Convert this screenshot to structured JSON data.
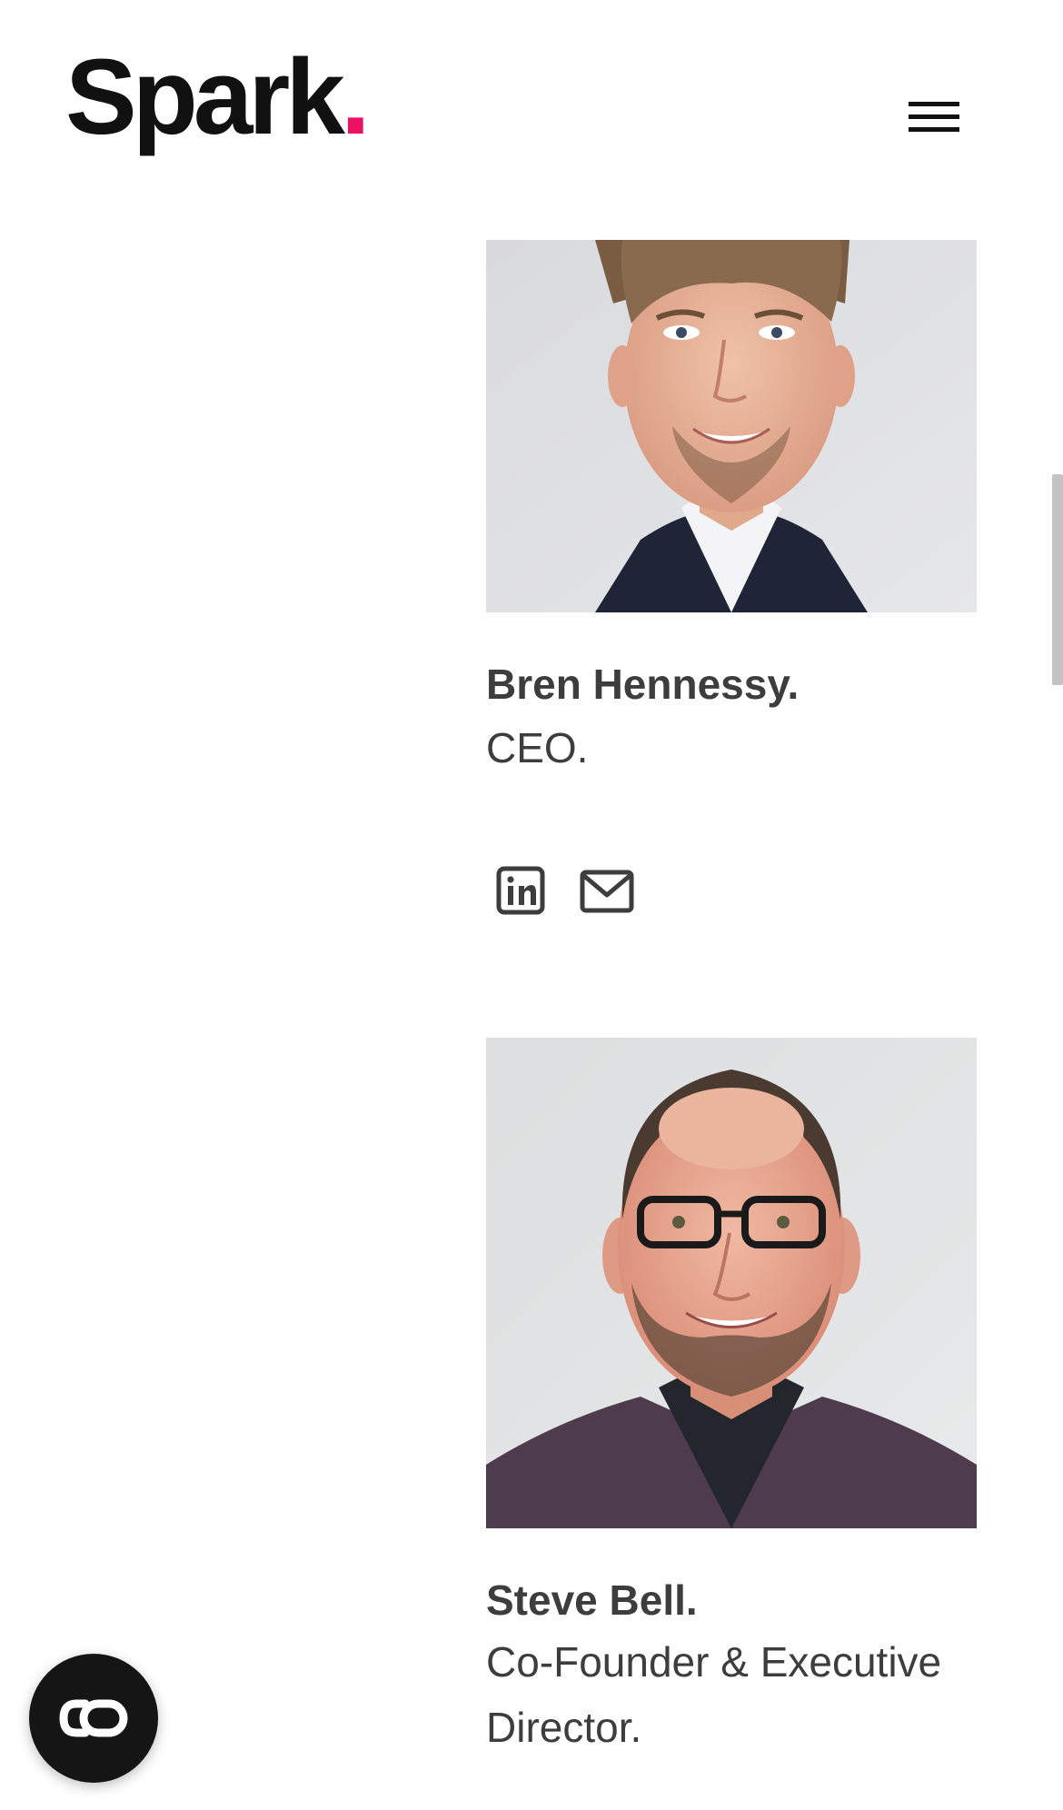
{
  "header": {
    "logo_text": "Spark",
    "logo_dot": ".",
    "accent_color": "#ec1165",
    "menu_icon": "hamburger-menu-icon"
  },
  "team": [
    {
      "name": "Bren Hennessy.",
      "role": "CEO.",
      "socials": [
        "linkedin-icon",
        "email-icon"
      ]
    },
    {
      "name": "Steve Bell.",
      "role": "Co-Founder & Executive Director."
    }
  ],
  "floating_button": {
    "icon": "accessibility-toggle-icon"
  }
}
